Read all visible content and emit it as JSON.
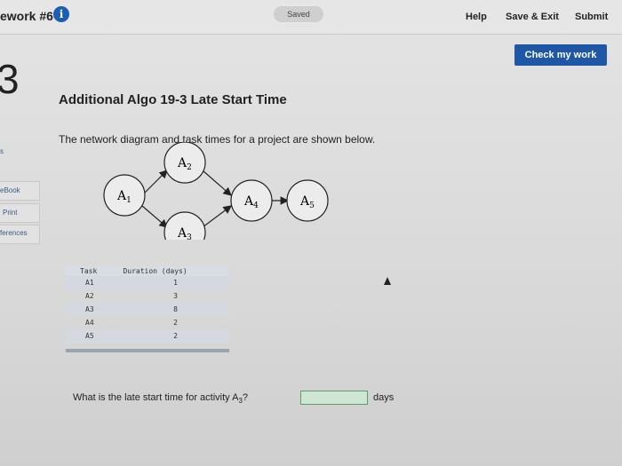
{
  "header": {
    "hw_title": "ework #6",
    "saved": "Saved",
    "help": "Help",
    "save_exit": "Save & Exit",
    "submit": "Submit"
  },
  "check_button": "Check my work",
  "question_number": "3",
  "sidebar": {
    "items": [
      {
        "label": "s"
      },
      {
        "label": "eBook"
      },
      {
        "label": "Print"
      },
      {
        "label": "ferences"
      }
    ]
  },
  "question": {
    "title": "Additional Algo 19-3 Late Start Time",
    "intro": "The network diagram and task times for a project are shown below.",
    "prompt_prefix": "What is the late start time for activity A",
    "prompt_sub": "3",
    "prompt_suffix": "?",
    "answer_value": "",
    "units": "days"
  },
  "diagram": {
    "nodes": [
      {
        "label": "A",
        "sub": "1"
      },
      {
        "label": "A",
        "sub": "2"
      },
      {
        "label": "A",
        "sub": "3"
      },
      {
        "label": "A",
        "sub": "4"
      },
      {
        "label": "A",
        "sub": "5"
      }
    ]
  },
  "table": {
    "headers": [
      "Task",
      "Duration (days)"
    ],
    "rows": [
      {
        "task": "A1",
        "duration": "1"
      },
      {
        "task": "A2",
        "duration": "3"
      },
      {
        "task": "A3",
        "duration": "8"
      },
      {
        "task": "A4",
        "duration": "2"
      },
      {
        "task": "A5",
        "duration": "2"
      }
    ]
  },
  "colors": {
    "accent": "#1d57a6",
    "info_icon": "#1a5fb4",
    "input_bg": "#cfe6d5"
  },
  "icons": {
    "info": "info-icon"
  }
}
